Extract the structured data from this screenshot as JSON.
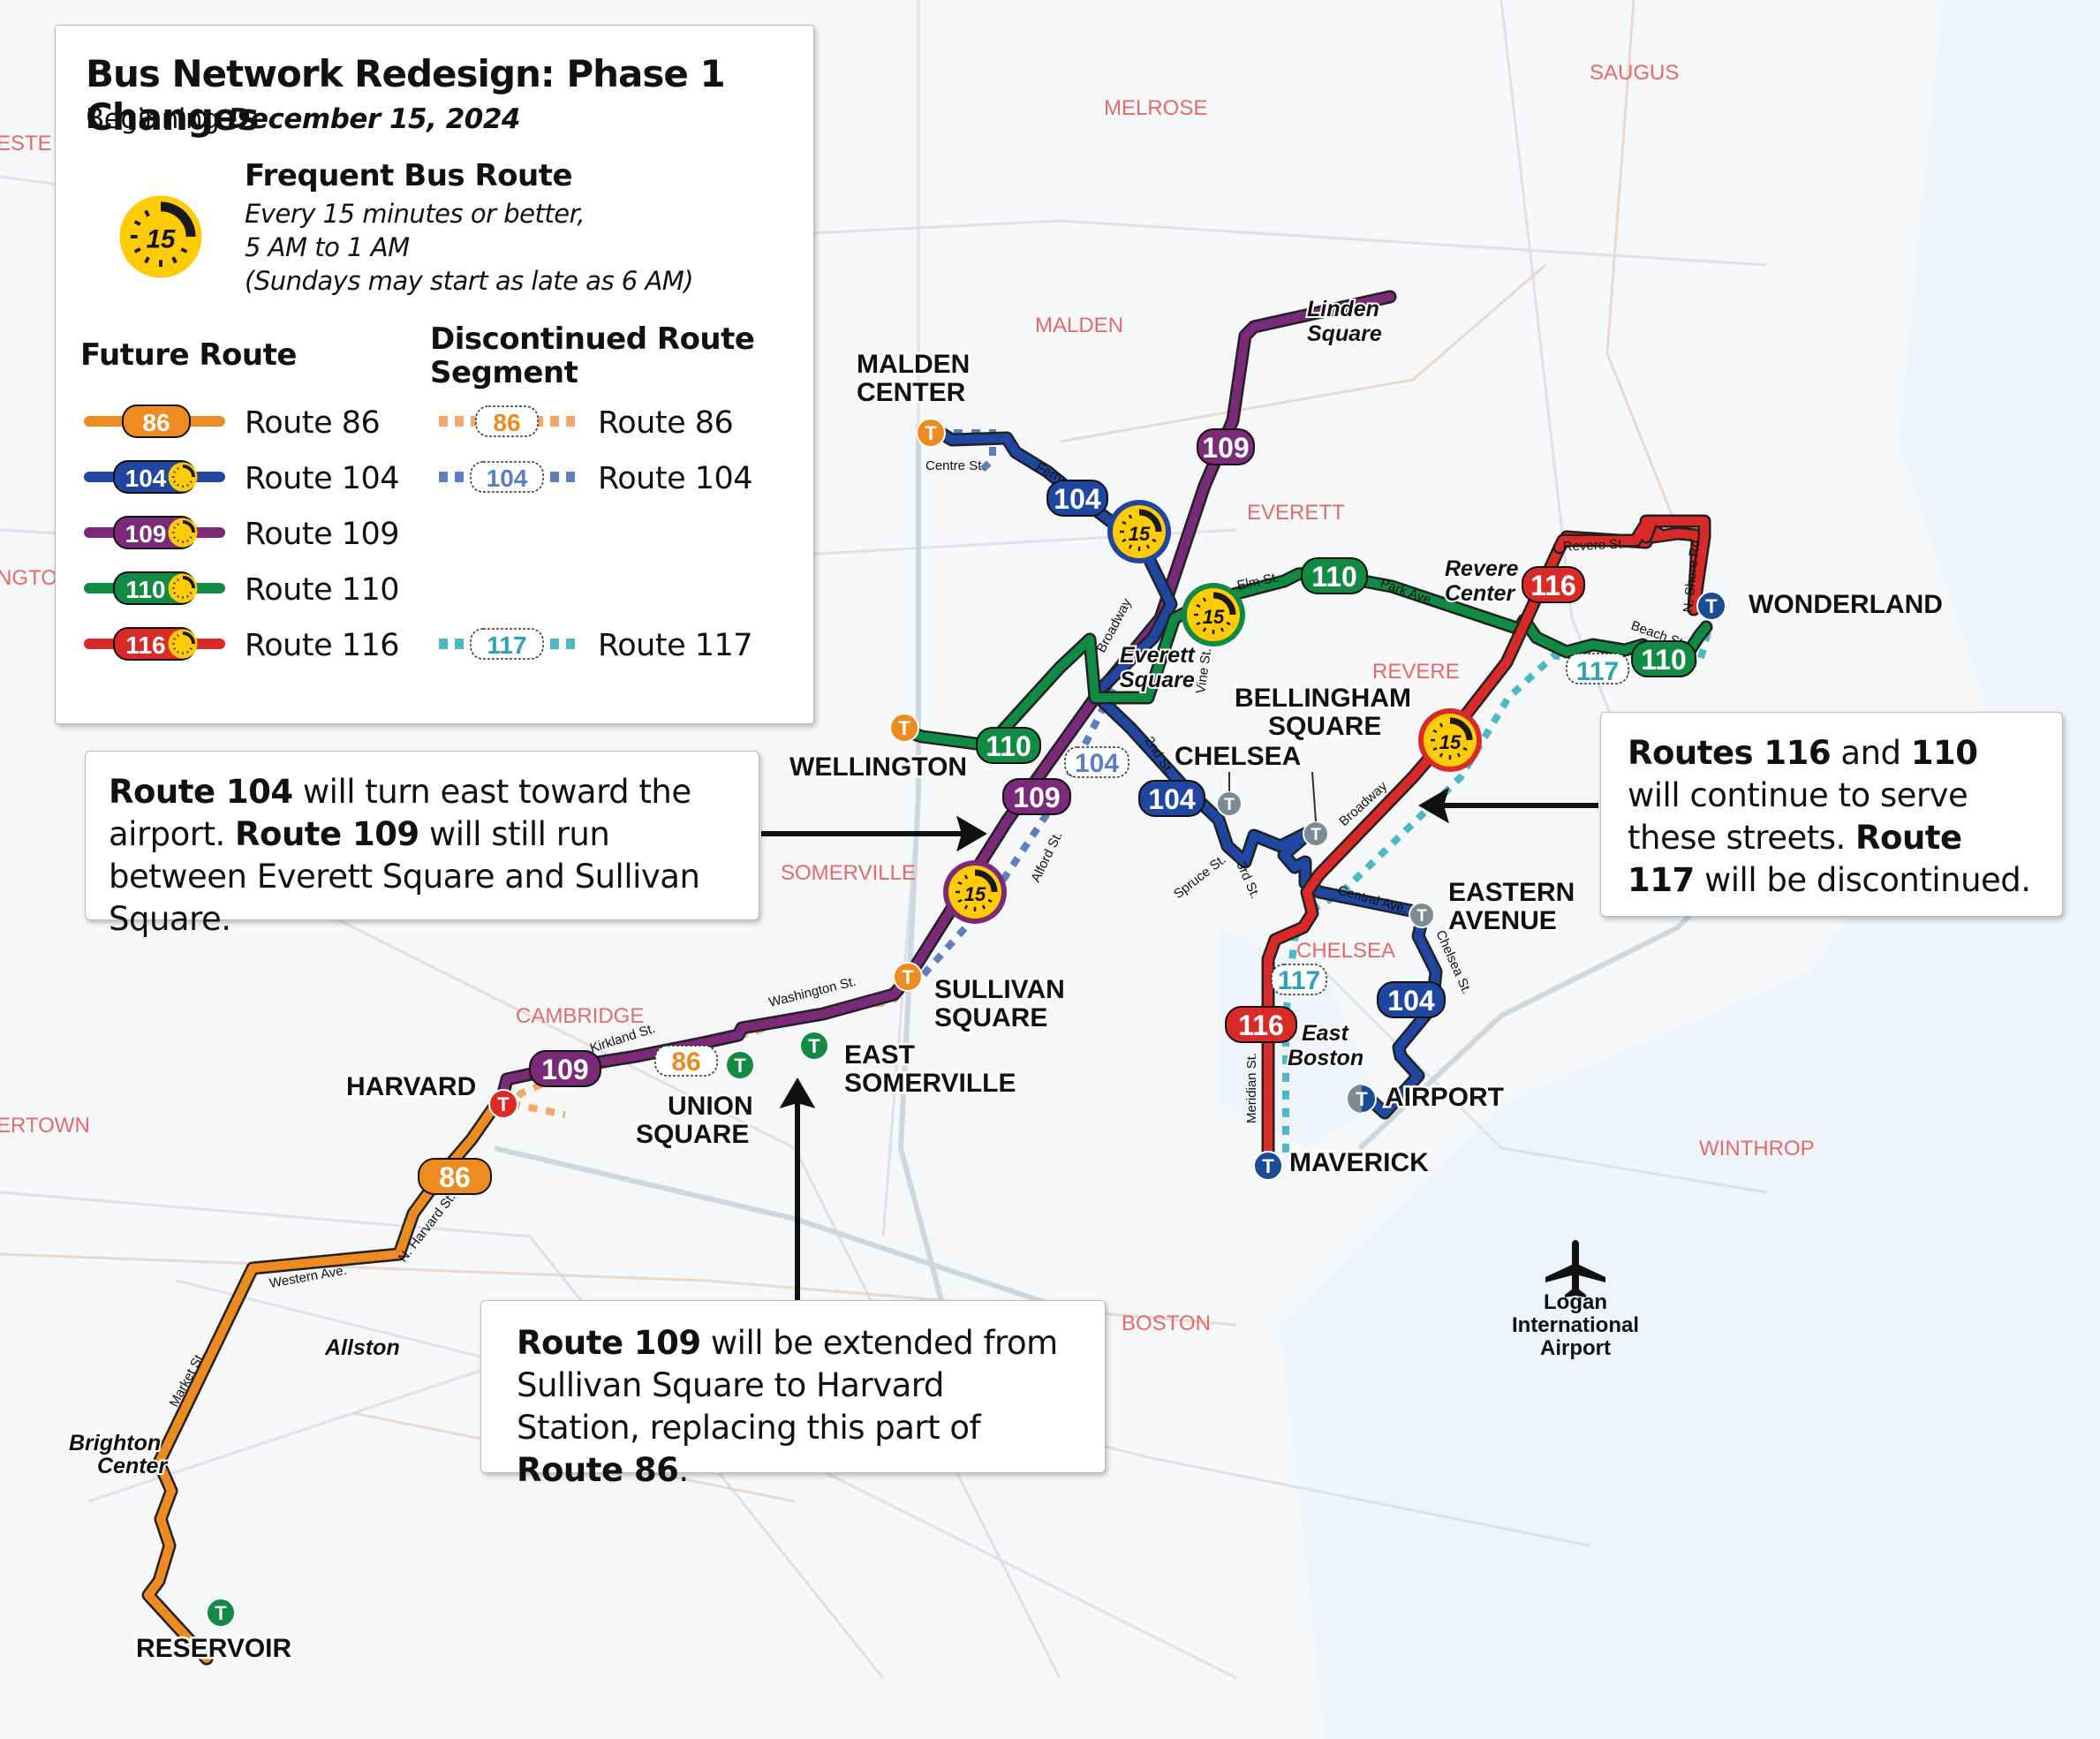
{
  "legend": {
    "title": "Bus Network Redesign: Phase 1 Changes",
    "subtitle_prefix": "Beginning",
    "subtitle_date": "December 15, 2024",
    "frequent": {
      "badge": "15",
      "title": "Frequent Bus Route",
      "lines": [
        "Every 15 minutes or better,",
        "5 AM to 1 AM",
        "(Sundays may start as late as 6 AM)"
      ]
    },
    "future_heading": "Future Route",
    "discontinued_heading_1": "Discontinued Route",
    "discontinued_heading_2": "Segment",
    "future_routes": [
      {
        "num": "86",
        "label": "Route 86",
        "color": "#ED8B21",
        "frequent": false
      },
      {
        "num": "104",
        "label": "Route 104",
        "color": "#1F46A0",
        "frequent": true
      },
      {
        "num": "109",
        "label": "Route 109",
        "color": "#7B2A7A",
        "frequent": true
      },
      {
        "num": "110",
        "label": "Route 110",
        "color": "#118A44",
        "frequent": true
      },
      {
        "num": "116",
        "label": "Route 116",
        "color": "#DA2A28",
        "frequent": true
      }
    ],
    "discontinued_routes": [
      {
        "num": "86",
        "label": "Route 86",
        "color": "#F1A868",
        "text_color": "#ED8B21"
      },
      {
        "num": "104",
        "label": "Route 104",
        "color": "#5E7EBF",
        "text_color": "#5E7EBF"
      },
      {
        "num": "117",
        "label": "Route 117",
        "color": "#4CB8C4",
        "text_color": "#2EA3B5"
      }
    ]
  },
  "callouts": {
    "route104": {
      "b1": "Route 104",
      "t1": " will turn east toward the airport. ",
      "b2": "Route 109",
      "t2": " will still run between Everett Square and Sullivan Square."
    },
    "route117": {
      "b1": "Routes 116",
      "t1": " and ",
      "b2": "110",
      "t2": " will continue to serve these streets. ",
      "b3": "Route 117",
      "t3": " will be discontinued."
    },
    "route109": {
      "b1": "Route 109",
      "t1": " will be extended from Sullivan Square to Harvard Station, replacing this part of ",
      "b2": "Route 86",
      "t2": "."
    }
  },
  "map": {
    "colors": {
      "r86": "#ED8B21",
      "r104": "#1F46A0",
      "r109": "#7B2A7A",
      "r110": "#118A44",
      "r116": "#DA2A28",
      "r117": "#4CB8C4",
      "freq": "#FFCB05",
      "d104": "#5E7EBF",
      "d86": "#F1A868",
      "orange_line": "#ED8B21",
      "green_line": "#118A44",
      "red_line": "#DA2A28",
      "blue_line": "#1A4B95",
      "silver": "#7C8A94"
    },
    "towns": [
      "MELROSE",
      "SAUGUS",
      "MALDEN",
      "EVERETT",
      "REVERE",
      "SOMERVILLE",
      "CAMBRIDGE",
      "CHELSEA",
      "WINTHROP",
      "BOSTON",
      "ESTE",
      "NGTO",
      "ERTOWN"
    ],
    "stations": {
      "malden_center_1": "MALDEN",
      "malden_center_2": "CENTER",
      "wellington": "WELLINGTON",
      "sullivan_1": "SULLIVAN",
      "sullivan_2": "SQUARE",
      "east_somerville_1": "EAST",
      "east_somerville_2": "SOMERVILLE",
      "union_1": "UNION",
      "union_2": "SQUARE",
      "harvard": "HARVARD",
      "reservoir": "RESERVOIR",
      "chelsea": "CHELSEA",
      "bellingham_1": "BELLINGHAM",
      "bellingham_2": "SQUARE",
      "eastern_1": "EASTERN",
      "eastern_2": "AVENUE",
      "airport": "AIRPORT",
      "maverick": "MAVERICK",
      "wonderland": "WONDERLAND"
    },
    "places": {
      "linden_1": "Linden",
      "linden_2": "Square",
      "everett_sq_1": "Everett",
      "everett_sq_2": "Square",
      "revere_center_1": "Revere",
      "revere_center_2": "Center",
      "east_boston_1": "East",
      "east_boston_2": "Boston",
      "allston": "Allston",
      "brighton_1": "Brighton",
      "brighton_2": "Center",
      "logan_1": "Logan",
      "logan_2": "International",
      "logan_3": "Airport"
    },
    "streets": [
      "Centre St.",
      "Ferry St.",
      "Broadway",
      "Elm St.",
      "Park Ave.",
      "Vine St.",
      "Revere St.",
      "N. Shore Rd",
      "Beach St.",
      "2nd St.",
      "Spruce St.",
      "3rd St.",
      "Central Ave.",
      "Chelsea St.",
      "Meridian St.",
      "Alford St.",
      "Washington St.",
      "Kirkland St.",
      "N. Harvard St.",
      "Western Ave.",
      "Market St.",
      "Broadway"
    ],
    "route_badges": {
      "b104a": "104",
      "b109a": "109",
      "b110a": "110",
      "b116a": "116",
      "b110b": "110",
      "b117a": "117",
      "b110c": "110",
      "b104d": "104",
      "b109b": "109",
      "b104b": "104",
      "b104c": "104",
      "b116b": "116",
      "b117b": "117",
      "b109c": "109",
      "b86d": "86",
      "b86a": "86"
    },
    "freq_badge": "15",
    "station_glyph": "T"
  }
}
